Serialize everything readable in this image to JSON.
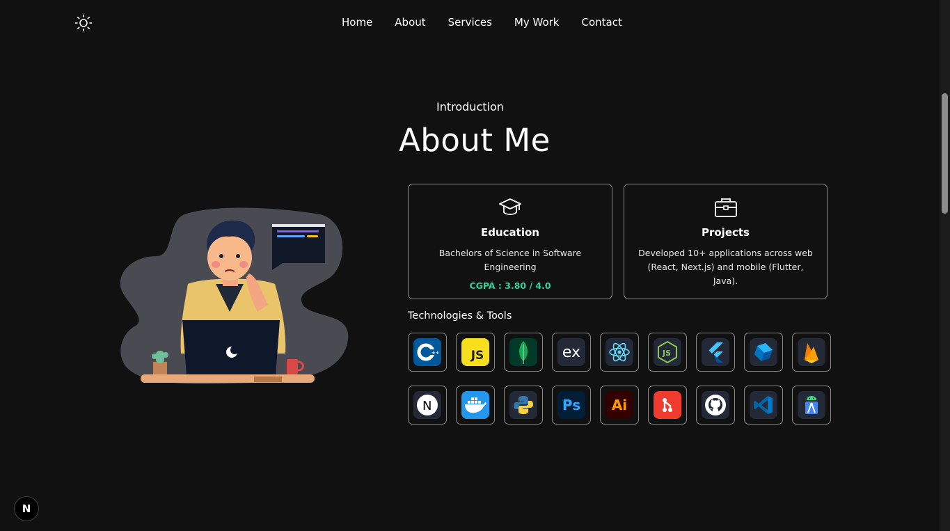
{
  "nav": {
    "theme_toggle_icon": "sun-icon",
    "links": [
      "Home",
      "About",
      "Services",
      "My Work",
      "Contact"
    ]
  },
  "section": {
    "eyebrow": "Introduction",
    "title": "About Me"
  },
  "cards": {
    "education": {
      "icon": "graduation-cap-icon",
      "title": "Education",
      "description": "Bachelors of Science in Software Engineering",
      "cgpa": "CGPA : 3.80 / 4.0"
    },
    "projects": {
      "icon": "briefcase-icon",
      "title": "Projects",
      "description": "Developed 10+ applications across web (React, Next.js) and mobile (Flutter, Java)."
    }
  },
  "tech": {
    "heading": "Technologies & Tools",
    "row1": [
      "c++-icon",
      "javascript-icon",
      "mongodb-icon",
      "express-icon",
      "react-icon",
      "nodejs-icon",
      "flutter-icon",
      "dart-icon",
      "firebase-icon"
    ],
    "row2": [
      "nextjs-icon",
      "docker-icon",
      "python-icon",
      "photoshop-icon",
      "illustrator-icon",
      "git-icon",
      "github-icon",
      "vscode-icon",
      "android-studio-icon"
    ]
  },
  "badges": {
    "js": "JS",
    "ex": "ex",
    "ps": "Ps",
    "ai": "Ai",
    "next": "N"
  },
  "colors": {
    "background": "#111111",
    "accent_cgpa": "#2fd39a",
    "border": "#8a8a8a"
  }
}
